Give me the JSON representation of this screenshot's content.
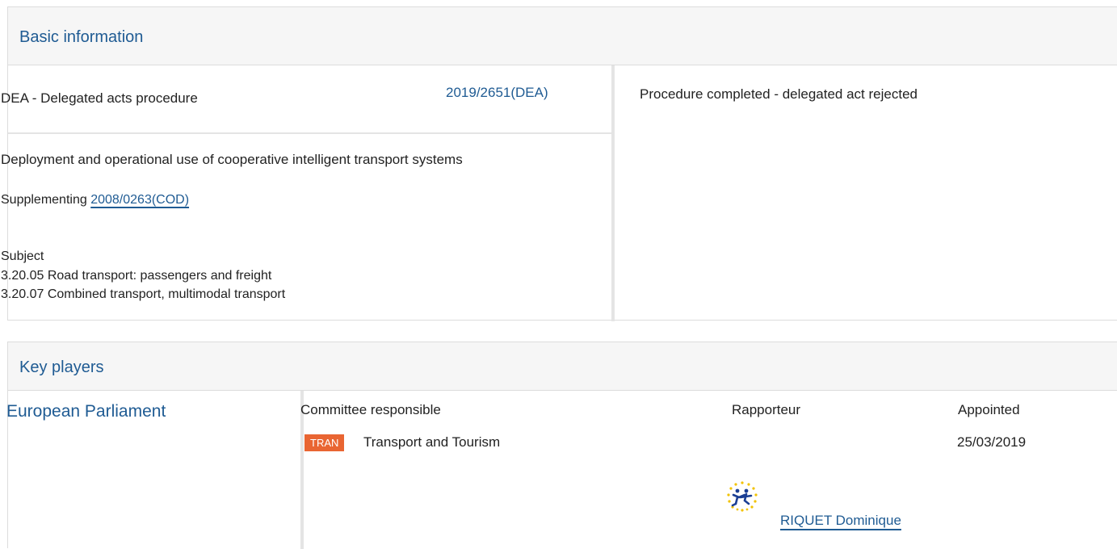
{
  "basic_info": {
    "header": "Basic information",
    "procedure_type": "DEA - Delegated acts procedure",
    "reference": "2019/2651(DEA)",
    "title": "Deployment and operational use of cooperative intelligent transport systems",
    "supplementing_label": "Supplementing",
    "supplementing_ref": "2008/0263(COD)",
    "subject_label": "Subject",
    "subjects": [
      "3.20.05 Road transport: passengers and freight",
      "3.20.07 Combined transport, multimodal transport"
    ],
    "status": "Procedure completed - delegated act rejected"
  },
  "key_players": {
    "header": "Key players",
    "institution": "European Parliament",
    "columns": {
      "committee": "Committee responsible",
      "rapporteur": "Rapporteur",
      "appointed": "Appointed"
    },
    "committee": {
      "badge": "TRAN",
      "name": "Transport and Tourism",
      "badge_color": "#e96532"
    },
    "appointed_date": "25/03/2019",
    "rapporteur": {
      "name": "RIQUET Dominique",
      "group_logo_icon": "renew-europe-logo-icon"
    }
  },
  "colors": {
    "link": "#1f5b93",
    "header_bg": "#f6f6f6",
    "border": "#dcdcdc"
  }
}
